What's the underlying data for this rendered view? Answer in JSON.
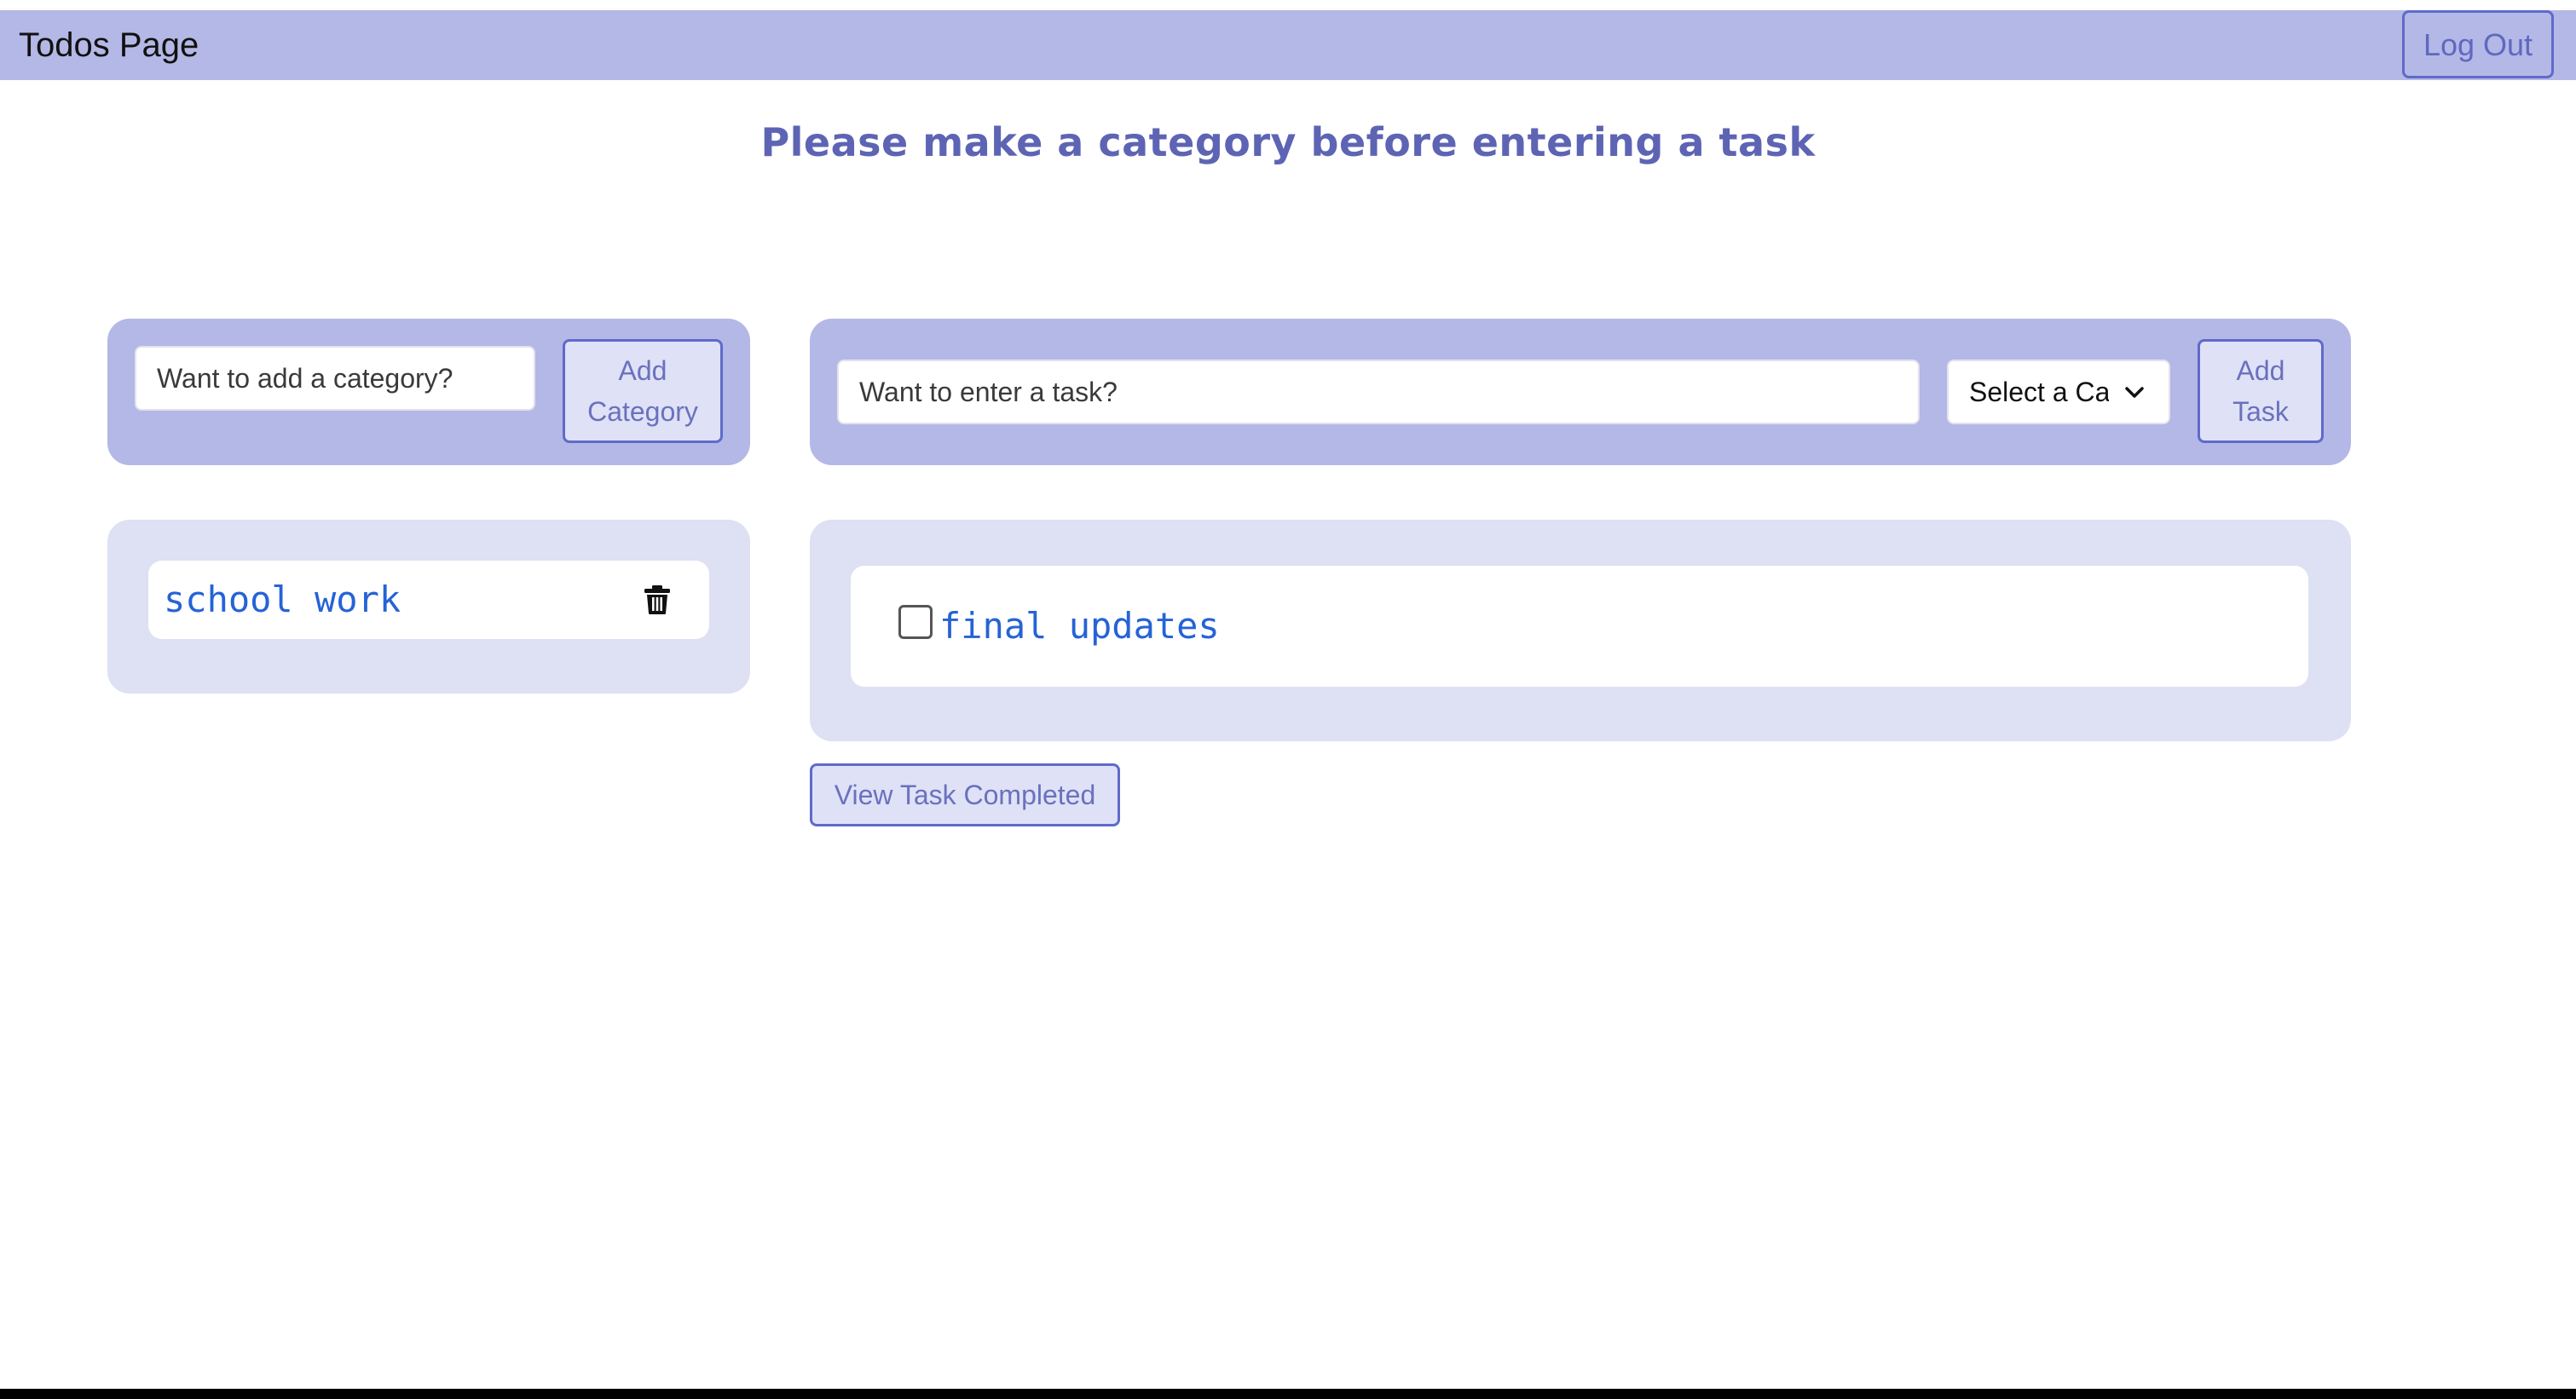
{
  "navbar": {
    "title": "Todos Page",
    "logout_label": "Log Out"
  },
  "notice": "Please make a category before entering a task",
  "category_form": {
    "placeholder": "Want to add a category?",
    "add_label_line1": "Add",
    "add_label_line2": "Category"
  },
  "task_form": {
    "placeholder": "Want to enter a task?",
    "select_value": "Select a Ca",
    "add_label_line1": "Add",
    "add_label_line2": "Task"
  },
  "categories": [
    {
      "name": "school work",
      "icon": "trash-icon"
    }
  ],
  "tasks": [
    {
      "text": "final updates",
      "completed": false
    }
  ],
  "view_completed_label": "View Task Completed",
  "colors": {
    "nav_bg": "#b4b8e6",
    "panel_light": "#dee0f3",
    "accent": "#5f6acb",
    "item_text": "#2563d6",
    "notice_text": "#5e64b4"
  }
}
